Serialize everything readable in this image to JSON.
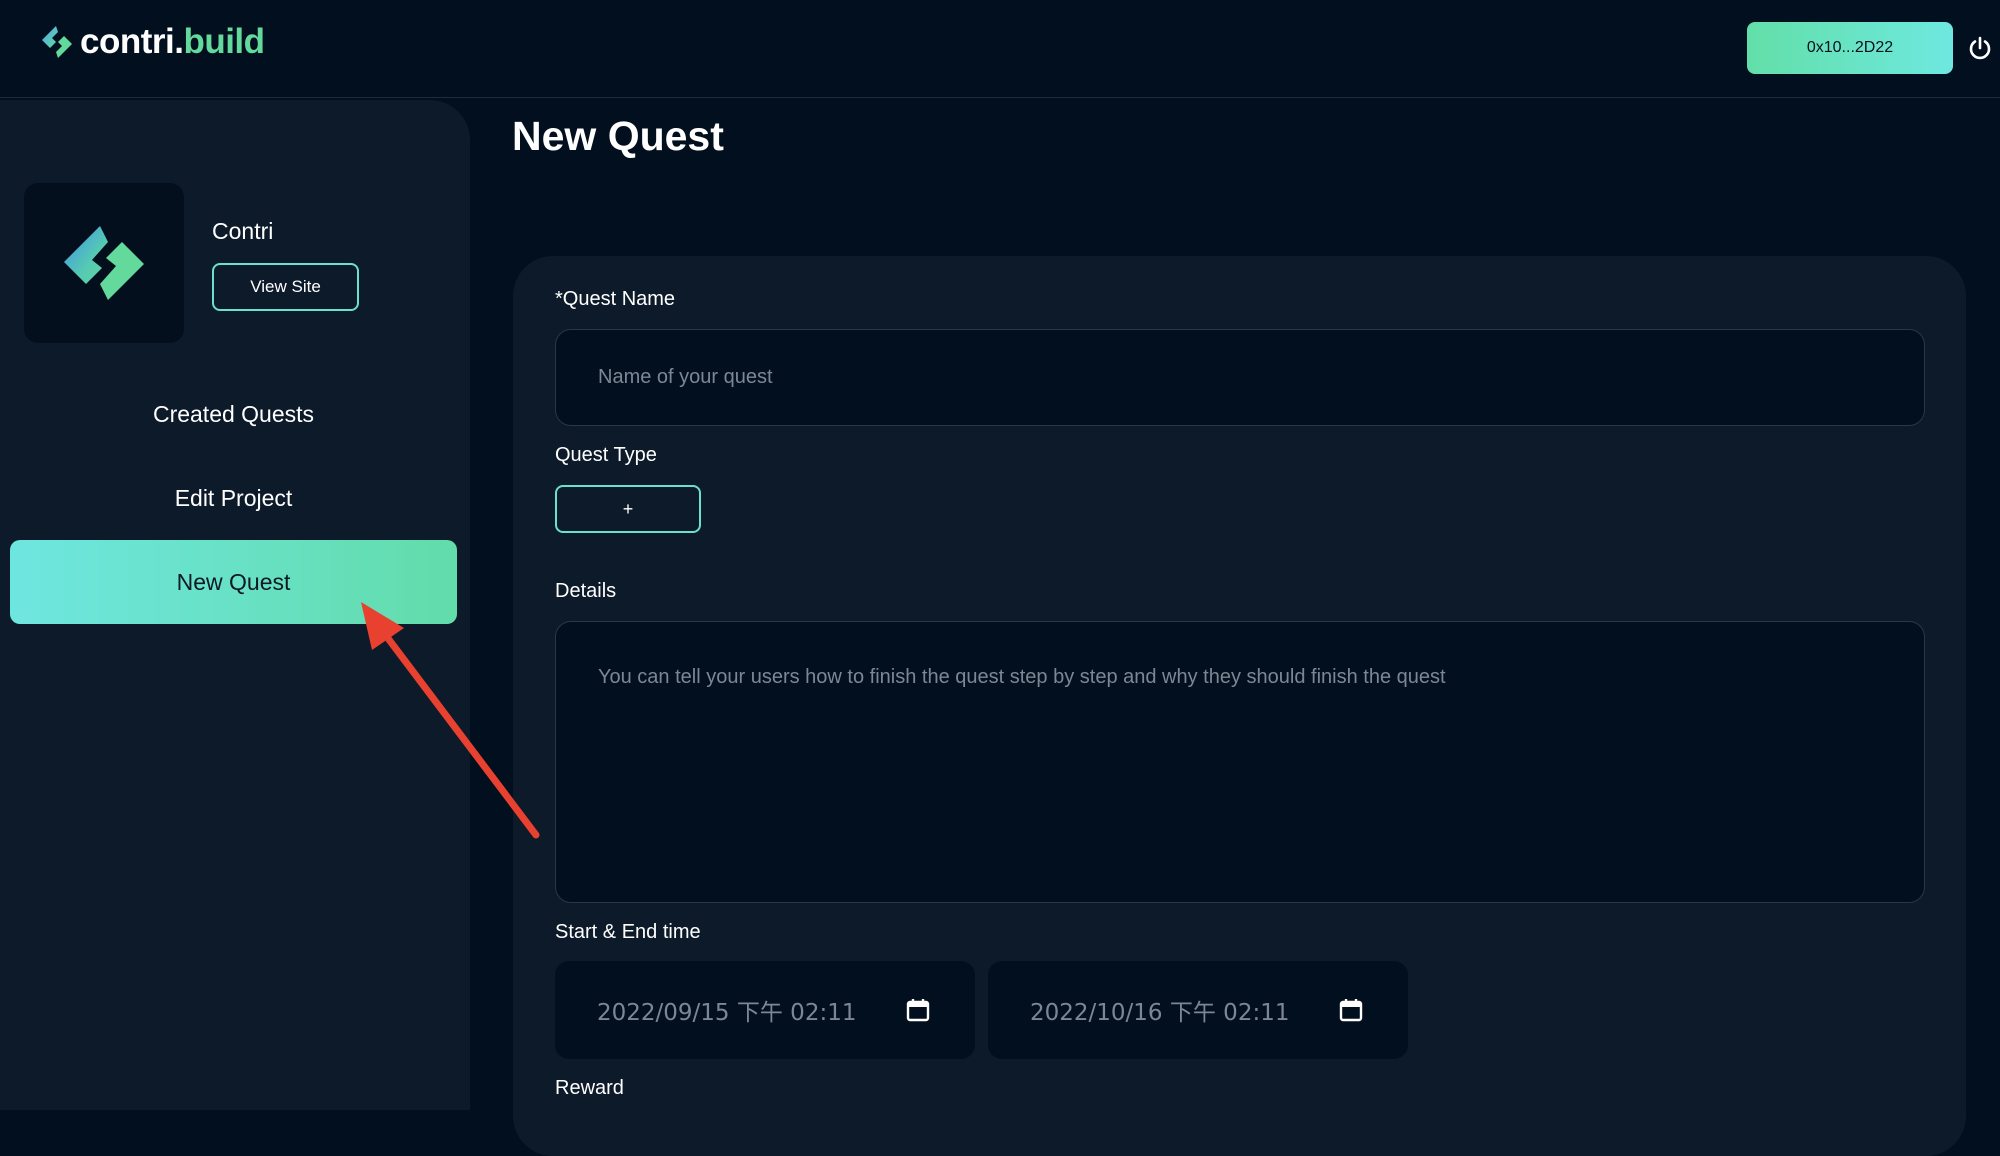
{
  "header": {
    "brand_part1": "contri.",
    "brand_part2": "build",
    "wallet_address": "0x10...2D22",
    "brand_gradient": [
      "#4fa8f0",
      "#63d99b"
    ],
    "accent": "#6be0cc"
  },
  "sidebar": {
    "project_name": "Contri",
    "view_site_label": "View Site",
    "items": [
      {
        "label": "Created Quests",
        "active": false
      },
      {
        "label": "Edit Project",
        "active": false
      },
      {
        "label": "New Quest",
        "active": true
      }
    ]
  },
  "main": {
    "title": "New Quest",
    "form": {
      "quest_name_label": "*Quest Name",
      "quest_name_placeholder": "Name of your quest",
      "quest_type_label": "Quest Type",
      "quest_type_add_label": "+",
      "details_label": "Details",
      "details_placeholder": "You can tell your users how to finish the quest step by step and why they should finish the quest",
      "time_label": "Start & End time",
      "start_time": "2022/09/15 下午 02:11",
      "end_time": "2022/10/16 下午 02:11",
      "reward_label": "Reward"
    }
  },
  "annotation": {
    "arrow_color": "#e8412f"
  }
}
